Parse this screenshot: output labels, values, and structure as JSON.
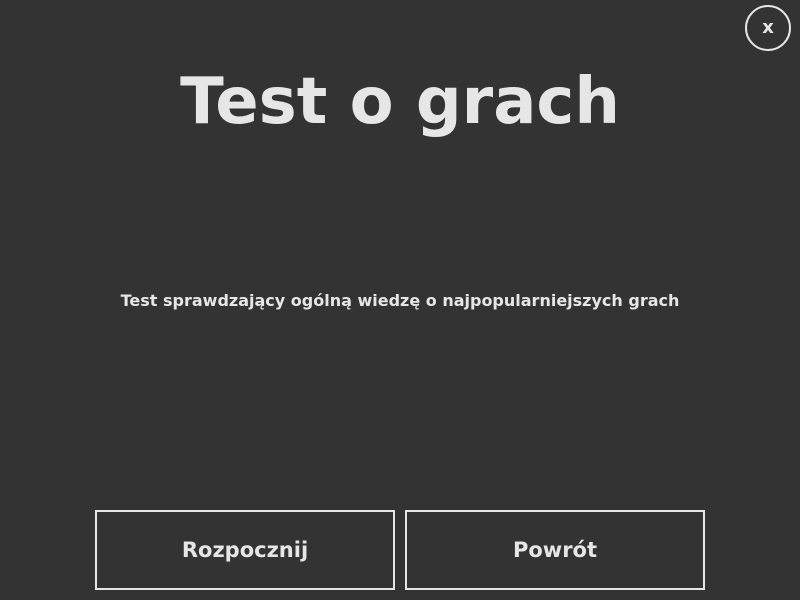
{
  "window": {
    "background": "#333333",
    "foreground": "#e6e6e6"
  },
  "close_button": {
    "label": "x",
    "icon": "close-icon"
  },
  "title": "Test o grach",
  "description": "Test sprawdzający ogólną wiedzę o najpopularniejszych grach",
  "buttons": {
    "start_label": "Rozpocznij",
    "back_label": "Powrót"
  }
}
